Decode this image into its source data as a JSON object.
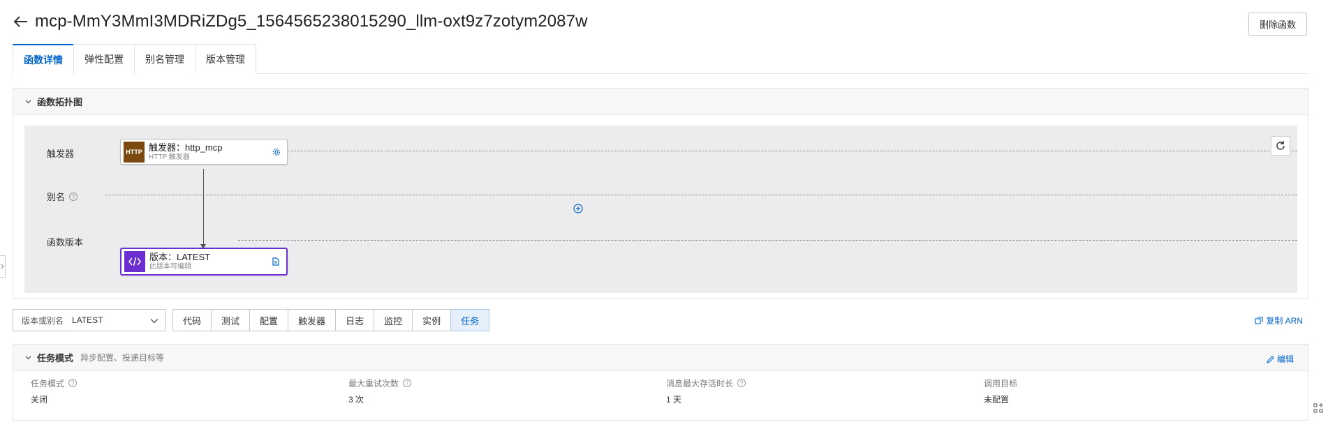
{
  "header": {
    "title": "mcp-MmY3MmI3MDRiZDg5_1564565238015290_llm-oxt9z7zotym2087w",
    "delete_label": "删除函数"
  },
  "tabs": [
    {
      "label": "函数详情",
      "active": true
    },
    {
      "label": "弹性配置",
      "active": false
    },
    {
      "label": "别名管理",
      "active": false
    },
    {
      "label": "版本管理",
      "active": false
    }
  ],
  "topology": {
    "title": "函数拓扑图",
    "rows": {
      "trigger": "触发器",
      "alias": "别名",
      "version": "函数版本"
    },
    "trigger_node": {
      "icon_text": "HTTP",
      "title": "触发器：http_mcp",
      "subtitle": "HTTP 触发器"
    },
    "version_node": {
      "title": "版本：LATEST",
      "subtitle": "此版本可编辑"
    }
  },
  "toolbar": {
    "version_label": "版本或别名",
    "version_value": "LATEST",
    "buttons": [
      {
        "label": "代码",
        "active": false
      },
      {
        "label": "测试",
        "active": false
      },
      {
        "label": "配置",
        "active": false
      },
      {
        "label": "触发器",
        "active": false
      },
      {
        "label": "日志",
        "active": false
      },
      {
        "label": "监控",
        "active": false
      },
      {
        "label": "实例",
        "active": false
      },
      {
        "label": "任务",
        "active": true
      }
    ],
    "copy_arn": "复制 ARN"
  },
  "task": {
    "title": "任务模式",
    "desc": "异步配置、投递目标等",
    "edit": "编辑",
    "fields": [
      {
        "label": "任务模式",
        "value": "关闭",
        "help": true
      },
      {
        "label": "最大重试次数",
        "value": "3 次",
        "help": true
      },
      {
        "label": "消息最大存活时长",
        "value": "1 天",
        "help": true
      },
      {
        "label": "调用目标",
        "value": "未配置",
        "help": false
      }
    ]
  },
  "colors": {
    "accent": "#0064c8",
    "trigger_icon": "#7a4a10",
    "version_border": "#6b2fd0"
  }
}
